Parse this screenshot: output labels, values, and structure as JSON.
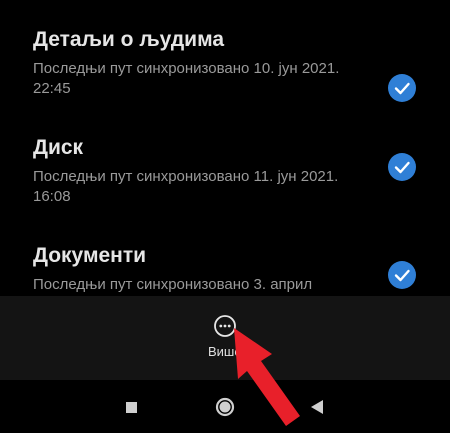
{
  "sync_items": [
    {
      "title": "Детаљи о људима",
      "subtitle": "Последњи пут синхронизовано 10. јун 2021. 22:45",
      "checked": true
    },
    {
      "title": "Диск",
      "subtitle": "Последњи пут синхронизовано 11. јун 2021. 16:08",
      "checked": true
    },
    {
      "title": "Документи",
      "subtitle": "Последњи пут синхронизовано 3. април",
      "checked": true
    }
  ],
  "bottom_bar": {
    "more_label": "Више",
    "more_icon": "more-horizontal-circle-icon"
  },
  "nav_bar": {
    "buttons": [
      "recents-square-icon",
      "home-circle-icon",
      "back-triangle-icon"
    ]
  },
  "colors": {
    "accent": "#2f7fd6",
    "annotation_arrow": "#e8202a",
    "background": "#000000",
    "bottom_bar": "#141414"
  }
}
